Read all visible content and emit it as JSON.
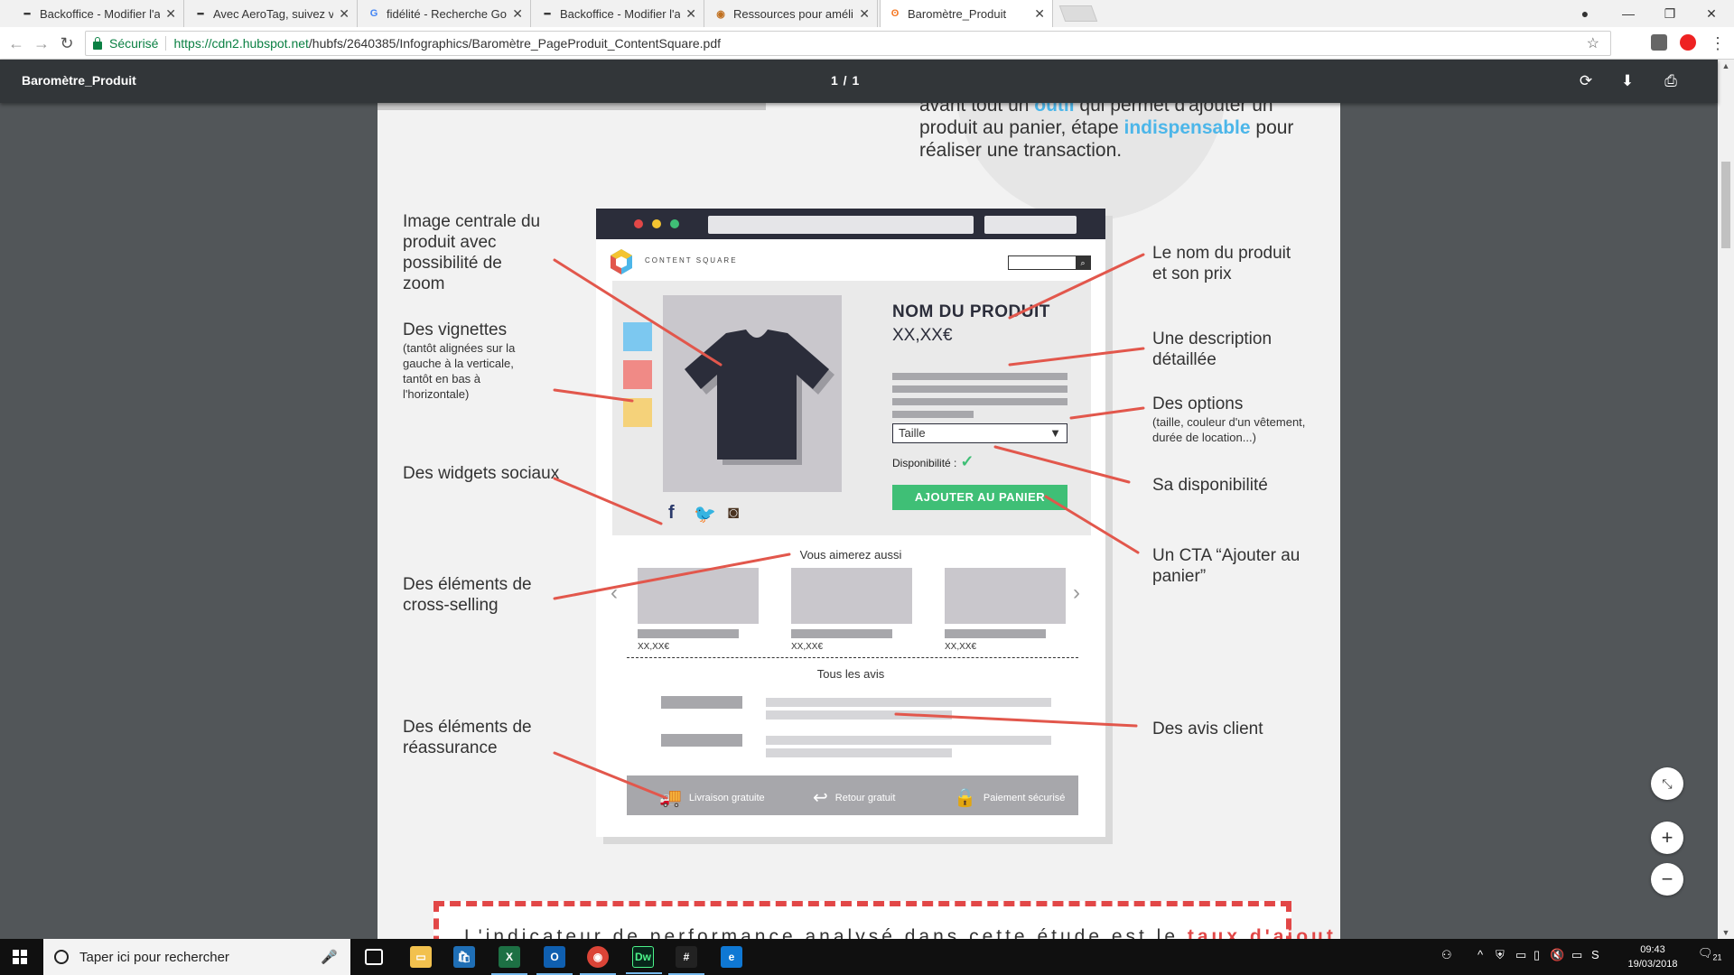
{
  "browser": {
    "tabs": [
      {
        "title": "Backoffice - Modifier l'ar",
        "favicon": "dash-icon"
      },
      {
        "title": "Avec AeroTag, suivez vot",
        "favicon": "dash-icon"
      },
      {
        "title": "fidélité - Recherche Goo",
        "favicon": "google-icon"
      },
      {
        "title": "Backoffice - Modifier l'ar",
        "favicon": "dash-icon"
      },
      {
        "title": "Ressources pour amélion",
        "favicon": "globe-icon"
      },
      {
        "title": "Baromètre_Produit",
        "favicon": "hubspot-icon",
        "active": true
      }
    ],
    "secure_label": "Sécurisé",
    "url_host": "https://cdn2.hubspot.net",
    "url_path": "/hubfs/2640385/Infographics/Baromètre_PageProduit_ContentSquare.pdf"
  },
  "pdf_viewer": {
    "title": "Baromètre_Produit",
    "page_indicator": "1  /  1"
  },
  "document": {
    "intro_parts": [
      "avant tout un ",
      "outil",
      " qui permet d'ajouter un produit au panier, étape ",
      "indispensable",
      " pour réaliser une transaction."
    ],
    "mockup": {
      "logo_text": "CONTENT SQUARE",
      "product_name": "NOM DU PRODUIT",
      "product_price": "XX,XX€",
      "select_label": "Taille",
      "availability_label": "Disponibilité :",
      "cta_label": "AJOUTER AU PANIER",
      "cross_sell_title": "Vous aimerez aussi",
      "cross_sell_prices": [
        "XX,XX€",
        "XX,XX€",
        "XX,XX€"
      ],
      "reviews_title": "Tous les avis",
      "reassurance": [
        "Livraison gratuite",
        "Retour gratuit",
        "Paiement sécurisé"
      ]
    },
    "annotations_left": {
      "image": "Image centrale du produit avec possibilité de zoom",
      "thumbs_title": "Des vignettes",
      "thumbs_note": "(tantôt alignées sur la gauche à la verticale, tantôt en bas à l'horizontale)",
      "social": "Des widgets sociaux",
      "cross_sell": "Des éléments de cross-selling",
      "reassurance": "Des éléments de réassurance"
    },
    "annotations_right": {
      "name_price": "Le nom du produit et son prix",
      "description": "Une description détaillée",
      "options_title": "Des options",
      "options_note": "(taille, couleur d'un vêtement, durée de location...)",
      "availability": "Sa disponibilité",
      "cta": "Un CTA “Ajouter au panier”",
      "reviews": "Des avis client"
    },
    "footer_box_parts": [
      "L'indicateur de performance analysé dans cette étude est le ",
      "taux d'ajout au panier"
    ]
  },
  "taskbar": {
    "search_placeholder": "Taper ici pour rechercher",
    "time": "09:43",
    "date": "19/03/2018",
    "notif_count": "21"
  },
  "colors": {
    "accent_blue": "#4cb6e9",
    "cta_green": "#3fbf76",
    "annotation_red": "#e2574c",
    "mock_dark": "#2b2d3a"
  }
}
